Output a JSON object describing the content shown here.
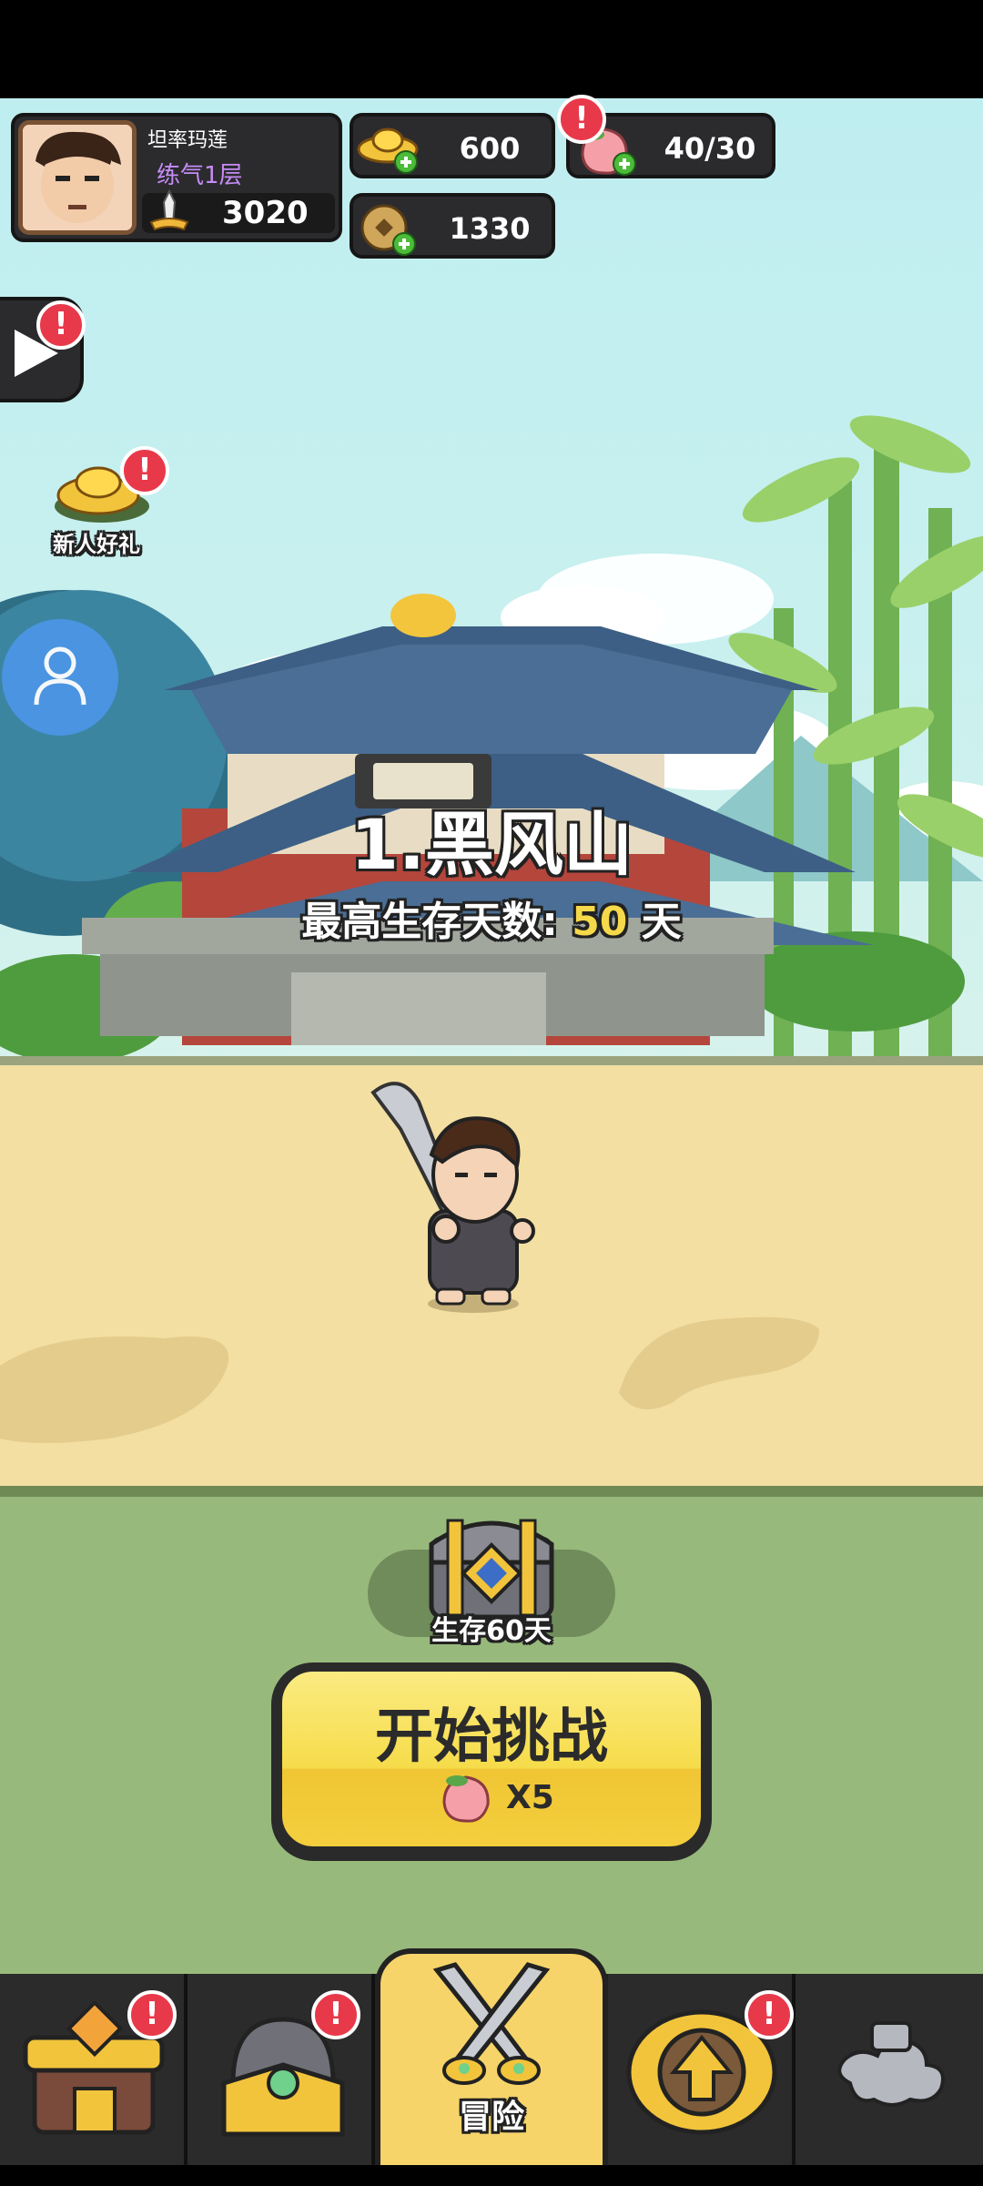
{
  "player": {
    "name": "坦率玛莲",
    "realm": "练气1层",
    "power": "3020"
  },
  "resources": {
    "gold": "600",
    "peach": "40/30",
    "coin": "1330"
  },
  "side": {
    "newbie_gift": "新人好礼"
  },
  "stage": {
    "title": "1.黑风山",
    "survival_label": "最高生存天数:",
    "survival_days": "50",
    "survival_unit": "天"
  },
  "reward": {
    "label": "生存60天"
  },
  "start": {
    "label": "开始挑战",
    "cost": "X5"
  },
  "nav": {
    "adventure": "冒险"
  },
  "colors": {
    "accent_yellow": "#f6d94a",
    "badge_red": "#e8394a",
    "panel_dark": "#2b2b2e"
  }
}
